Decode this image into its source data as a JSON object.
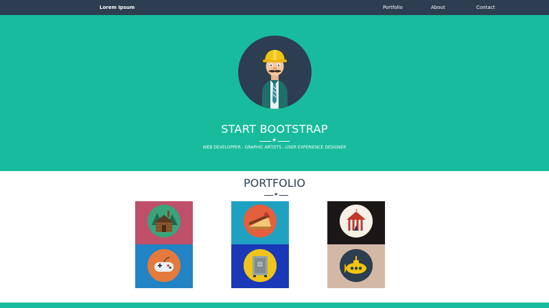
{
  "navbar": {
    "brand": "Lorem Ipsum",
    "links": [
      "Portfolio",
      "About",
      "Contact"
    ]
  },
  "hero": {
    "title": "START BOOTSTRAP",
    "subtitle": "WEB DEVELOPPER - GRAPHIC ARTISTS - USER EXPERIENCE DESIGNER",
    "divider_icon": "star-icon",
    "avatar_icon": "construction-worker-icon"
  },
  "portfolio": {
    "title": "PORTFOLIO",
    "divider_icon": "star-icon",
    "items": [
      {
        "icon": "cabin-icon"
      },
      {
        "icon": "cake-slice-icon"
      },
      {
        "icon": "circus-tent-icon"
      },
      {
        "icon": "game-controller-icon"
      },
      {
        "icon": "safe-icon"
      },
      {
        "icon": "submarine-icon"
      }
    ]
  },
  "colors": {
    "primary": "#2c3e50",
    "accent": "#18bc9c",
    "white": "#ffffff"
  }
}
